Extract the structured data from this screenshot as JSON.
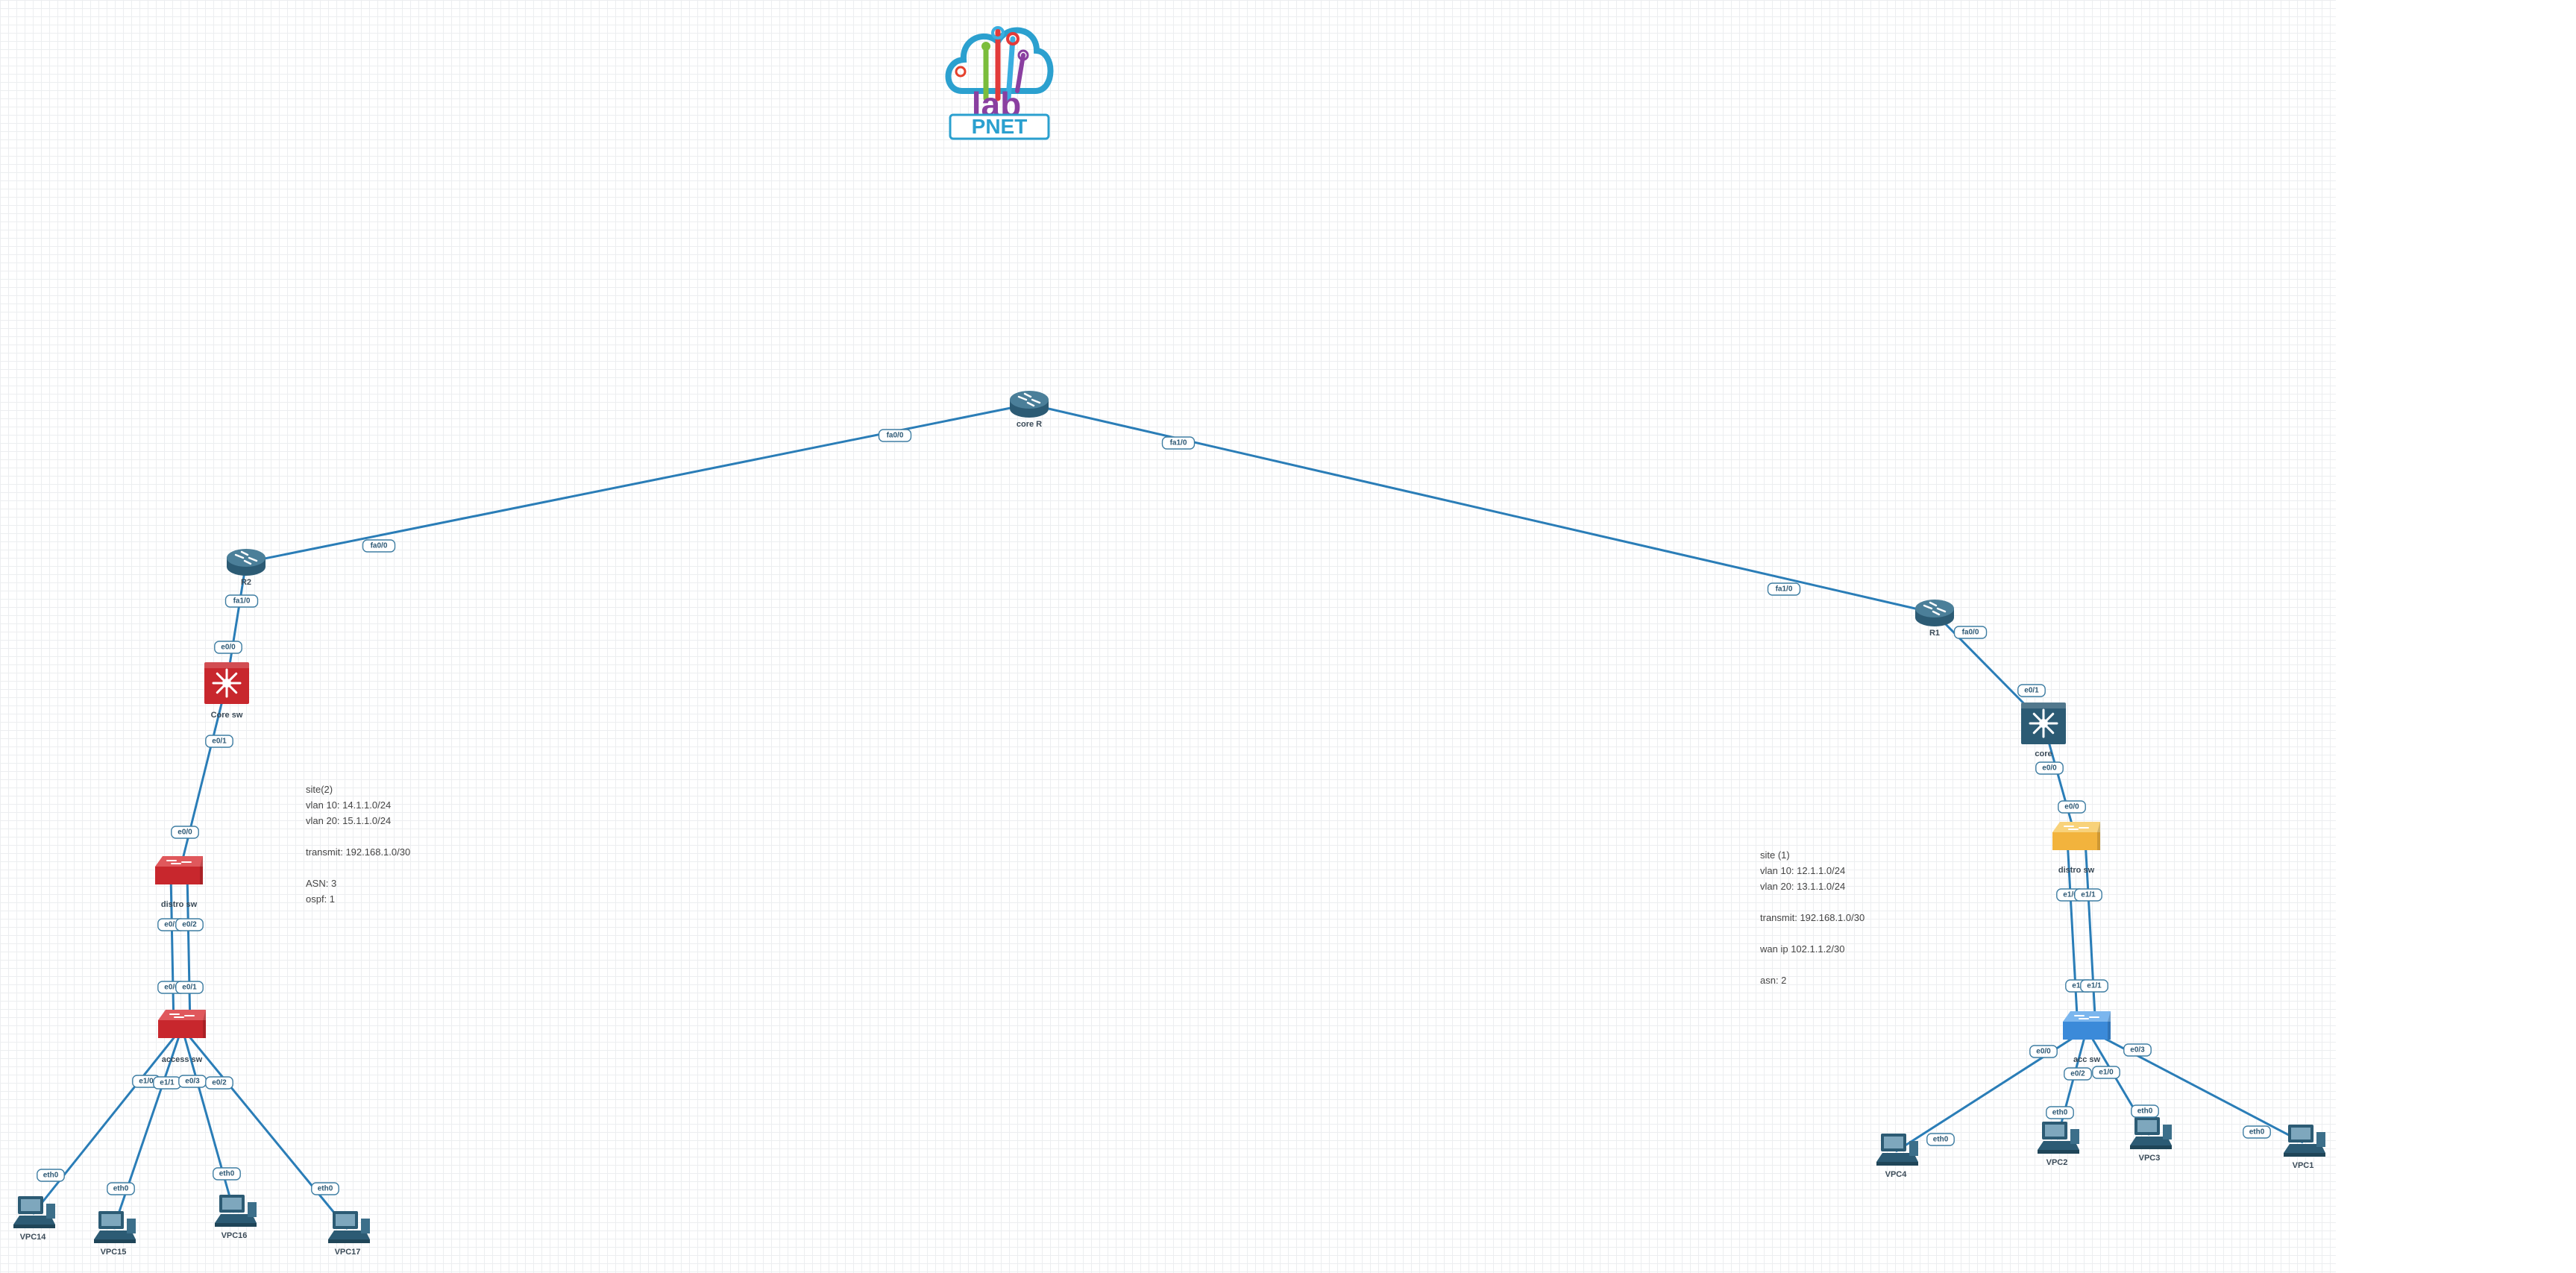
{
  "logo": {
    "main": "lab",
    "sub": "PNET"
  },
  "colors": {
    "link": "#2a7db7",
    "router": "#2c5b74",
    "red_switch": "#c8272d",
    "yellow_switch": "#f2b33d",
    "blue_switch": "#3b8ad9"
  },
  "nodes": [
    {
      "id": "coreR",
      "label": "core R",
      "icon": "router-icon"
    },
    {
      "id": "R2",
      "label": "R2",
      "icon": "router-icon"
    },
    {
      "id": "R1",
      "label": "R1",
      "icon": "router-icon"
    },
    {
      "id": "coresw",
      "label": "Core sw",
      "icon": "multilayer-switch-red-icon"
    },
    {
      "id": "core",
      "label": "core",
      "icon": "multilayer-switch-icon"
    },
    {
      "id": "distrosw2",
      "label": "distro sw",
      "icon": "switch-red-icon"
    },
    {
      "id": "distrosw1",
      "label": "distro sw",
      "icon": "switch-yellow-icon"
    },
    {
      "id": "accesssw",
      "label": "access sw",
      "icon": "switch-red-icon"
    },
    {
      "id": "accsw",
      "label": "acc sw",
      "icon": "switch-blue-icon"
    },
    {
      "id": "VPC14",
      "label": "VPC14",
      "icon": "pc-icon"
    },
    {
      "id": "VPC15",
      "label": "VPC15",
      "icon": "pc-icon"
    },
    {
      "id": "VPC16",
      "label": "VPC16",
      "icon": "pc-icon"
    },
    {
      "id": "VPC17",
      "label": "VPC17",
      "icon": "pc-icon"
    },
    {
      "id": "VPC4",
      "label": "VPC4",
      "icon": "pc-icon"
    },
    {
      "id": "VPC2",
      "label": "VPC2",
      "icon": "pc-icon"
    },
    {
      "id": "VPC3",
      "label": "VPC3",
      "icon": "pc-icon"
    },
    {
      "id": "VPC1",
      "label": "VPC1",
      "icon": "pc-icon"
    }
  ],
  "links": [
    {
      "from": "coreR",
      "to": "R2",
      "from_port": "fa0/0",
      "to_port": "fa0/0"
    },
    {
      "from": "coreR",
      "to": "R1",
      "from_port": "fa1/0",
      "to_port": "fa1/0"
    },
    {
      "from": "R2",
      "to": "coresw",
      "from_port": "fa1/0",
      "to_port": "e0/0"
    },
    {
      "from": "coresw",
      "to": "distrosw2",
      "from_port": "e0/1",
      "to_port": "e0/0"
    },
    {
      "from": "distrosw2",
      "to": "accesssw",
      "from_port": "e0/1",
      "to_port": "e0/0"
    },
    {
      "from": "distrosw2",
      "to": "accesssw",
      "from_port": "e0/2",
      "to_port": "e0/1"
    },
    {
      "from": "accesssw",
      "to": "VPC14",
      "from_port": "e1/0",
      "to_port": "eth0"
    },
    {
      "from": "accesssw",
      "to": "VPC15",
      "from_port": "e1/1",
      "to_port": "eth0"
    },
    {
      "from": "accesssw",
      "to": "VPC16",
      "from_port": "e0/3",
      "to_port": "eth0"
    },
    {
      "from": "accesssw",
      "to": "VPC17",
      "from_port": "e0/2",
      "to_port": "eth0"
    },
    {
      "from": "R1",
      "to": "core",
      "from_port": "fa0/0",
      "to_port": "e0/1"
    },
    {
      "from": "core",
      "to": "distrosw1",
      "from_port": "e0/0",
      "to_port": "e0/0"
    },
    {
      "from": "distrosw1",
      "to": "accsw",
      "from_port": "e1/0",
      "to_port": "e1/0"
    },
    {
      "from": "distrosw1",
      "to": "accsw",
      "from_port": "e1/1",
      "to_port": "e1/1"
    },
    {
      "from": "accsw",
      "to": "VPC4",
      "from_port": "e0/0",
      "to_port": "eth0"
    },
    {
      "from": "accsw",
      "to": "VPC2",
      "from_port": "e0/2",
      "to_port": "eth0"
    },
    {
      "from": "accsw",
      "to": "VPC3",
      "from_port": "e1/0",
      "to_port": "eth0"
    },
    {
      "from": "accsw",
      "to": "VPC1",
      "from_port": "e0/3",
      "to_port": "eth0"
    }
  ],
  "notes": {
    "site2": [
      "site(2)",
      "vlan 10: 14.1.1.0/24",
      "vlan 20: 15.1.1.0/24",
      "",
      "transmit: 192.168.1.0/30",
      "",
      "ASN: 3",
      "ospf: 1"
    ],
    "site1": [
      "site (1)",
      "vlan 10: 12.1.1.0/24",
      "vlan 20: 13.1.1.0/24",
      "",
      "transmit: 192.168.1.0/30",
      "",
      "wan ip 102.1.1.2/30",
      "",
      "asn: 2"
    ]
  }
}
